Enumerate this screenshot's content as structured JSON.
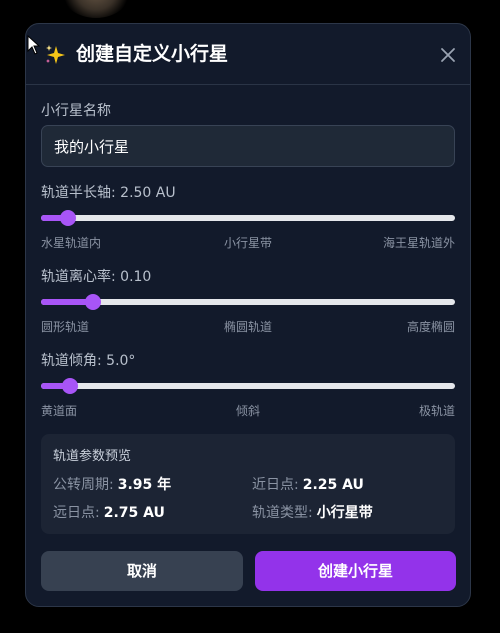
{
  "dialog": {
    "title": "创建自定义小行星",
    "title_icon": "sparkles-icon",
    "close_icon": "close-icon"
  },
  "name_field": {
    "label": "小行星名称",
    "value": "我的小行星"
  },
  "semi_major_axis": {
    "label": "轨道半长轴: 2.50 AU",
    "value_fraction": 0.065,
    "ticks": [
      "水星轨道内",
      "小行星带",
      "海王星轨道外"
    ]
  },
  "eccentricity": {
    "label": "轨道离心率: 0.10",
    "value_fraction": 0.125,
    "ticks": [
      "圆形轨道",
      "椭圆轨道",
      "高度椭圆"
    ]
  },
  "inclination": {
    "label": "轨道倾角: 5.0°",
    "value_fraction": 0.07,
    "ticks": [
      "黄道面",
      "倾斜",
      "极轨道"
    ]
  },
  "preview": {
    "title": "轨道参数预览",
    "period_label": "公转周期:",
    "period_value": "3.95 年",
    "perihelion_label": "近日点:",
    "perihelion_value": "2.25 AU",
    "aphelion_label": "远日点:",
    "aphelion_value": "2.75 AU",
    "type_label": "轨道类型:",
    "type_value": "小行星带"
  },
  "buttons": {
    "cancel": "取消",
    "create": "创建小行星"
  },
  "colors": {
    "accent": "#a855f7",
    "create_button": "#9333ea",
    "cancel_button": "#374151",
    "panel": "#121a2b"
  }
}
